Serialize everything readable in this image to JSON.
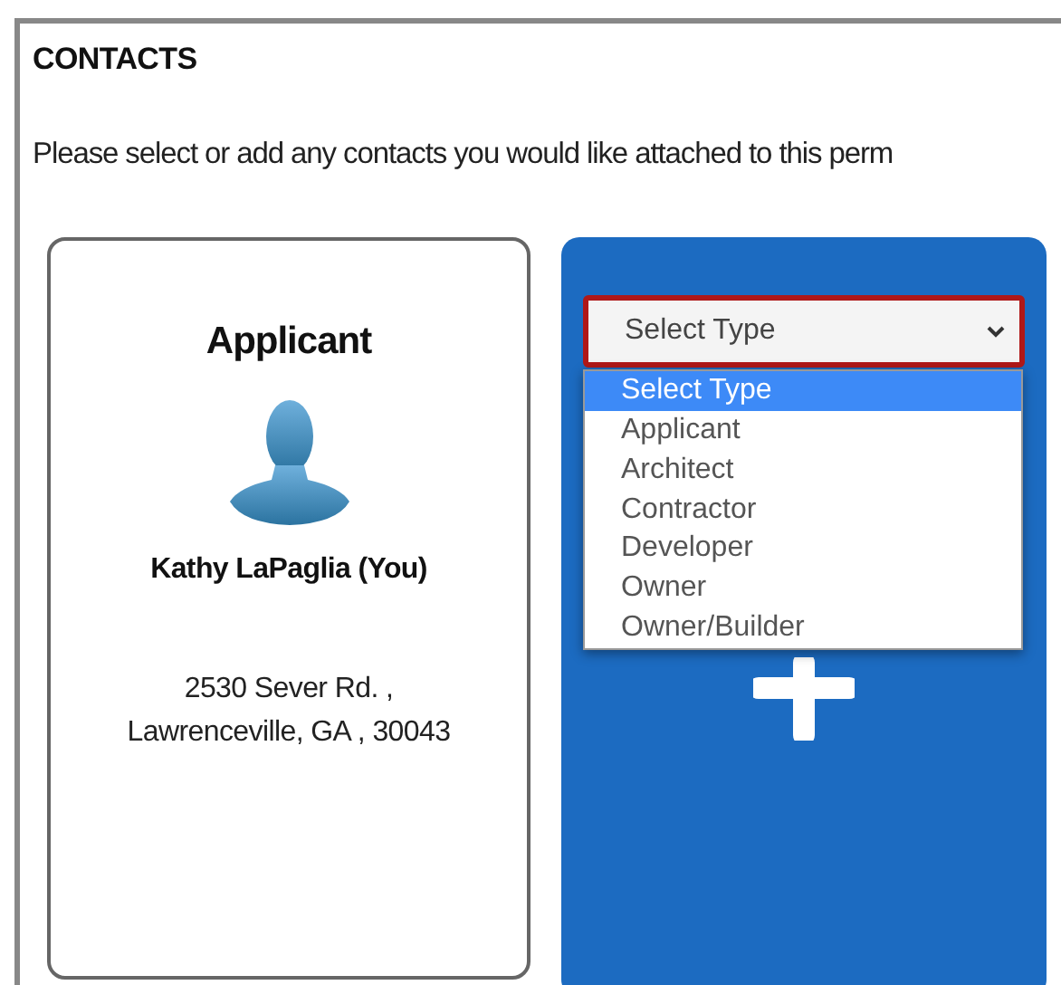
{
  "section": {
    "title": "CONTACTS",
    "instructions": "Please select or add any contacts you would like attached to this perm"
  },
  "contact_card": {
    "role": "Applicant",
    "name": "Kathy LaPaglia (You)",
    "address_line_1": "2530 Sever Rd. ,",
    "address_line_2": "Lawrenceville, GA , 30043"
  },
  "add_card": {
    "select": {
      "value": "Select Type",
      "open": true
    },
    "options": [
      {
        "label": "Select Type",
        "selected": true
      },
      {
        "label": "Applicant",
        "selected": false
      },
      {
        "label": "Architect",
        "selected": false
      },
      {
        "label": "Contractor",
        "selected": false
      },
      {
        "label": "Developer",
        "selected": false
      },
      {
        "label": "Owner",
        "selected": false
      },
      {
        "label": "Owner/Builder",
        "selected": false
      }
    ]
  }
}
